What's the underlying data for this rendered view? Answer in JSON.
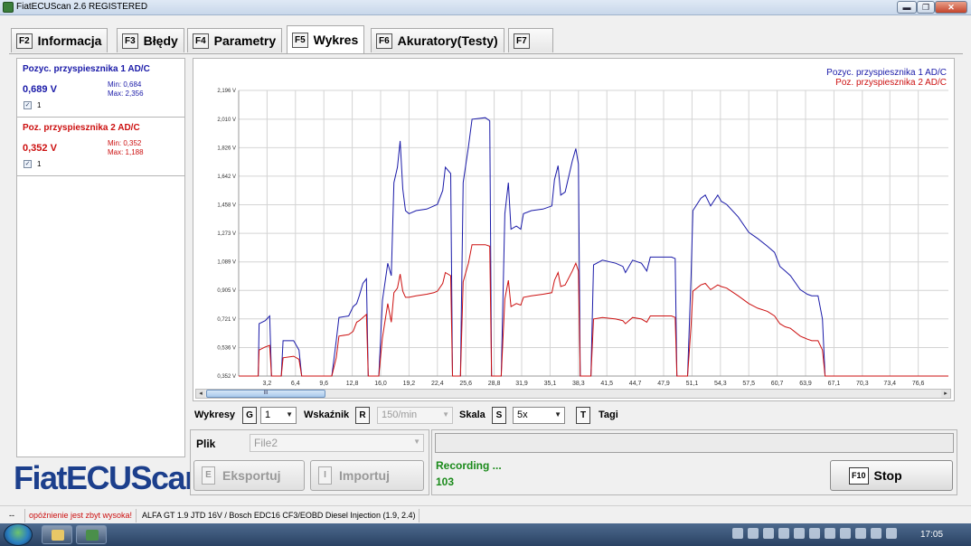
{
  "window": {
    "title": "FiatECUScan 2.6 REGISTERED",
    "min_glyph": "▬",
    "restore_glyph": "❐",
    "close_glyph": "✕"
  },
  "tabs": [
    {
      "key": "F2",
      "label": "Informacja"
    },
    {
      "key": "F3",
      "label": "Błędy"
    },
    {
      "key": "F4",
      "label": "Parametry"
    },
    {
      "key": "F5",
      "label": "Wykres",
      "active": true
    },
    {
      "key": "F6",
      "label": "Akuratory(Testy)"
    },
    {
      "key": "F7",
      "label": ""
    }
  ],
  "sensors": [
    {
      "name": "Pozyc. przyspiesznika 1 AD/C",
      "value": "0,689 V",
      "min": "Min: 0,684",
      "max": "Max: 2,356",
      "checkbox_label": "1",
      "checked": true,
      "color": "#1a1aa8"
    },
    {
      "name": "Poz. przyspiesznika 2 AD/C",
      "value": "0,352 V",
      "min": "Min: 0,352",
      "max": "Max: 1,188",
      "checkbox_label": "1",
      "checked": true,
      "color": "#cc1010"
    }
  ],
  "logo": "FiatECUScan",
  "chart_data": {
    "type": "line",
    "title": "",
    "xlabel": "",
    "ylabel": "",
    "xlim": [
      0,
      80
    ],
    "ylim": [
      0.352,
      2.196
    ],
    "x_ticks": [
      "3,2",
      "6,4",
      "9,6",
      "12,8",
      "16,0",
      "19,2",
      "22,4",
      "25,6",
      "28,8",
      "31,9",
      "35,1",
      "38,3",
      "41,5",
      "44,7",
      "47,9",
      "51,1",
      "54,3",
      "57,5",
      "60,7",
      "63,9",
      "67,1",
      "70,3",
      "73,4",
      "76,6"
    ],
    "x_tick_values": [
      3.2,
      6.4,
      9.6,
      12.8,
      16.0,
      19.2,
      22.4,
      25.6,
      28.8,
      31.9,
      35.1,
      38.3,
      41.5,
      44.7,
      47.9,
      51.1,
      54.3,
      57.5,
      60.7,
      63.9,
      67.1,
      70.3,
      73.4,
      76.6
    ],
    "y_ticks": [
      "0,352 V",
      "0,536 V",
      "0,721 V",
      "0,905 V",
      "1,089 V",
      "1,273 V",
      "1,458 V",
      "1,642 V",
      "1,826 V",
      "2,010 V",
      "2,196 V"
    ],
    "y_tick_values": [
      0.352,
      0.536,
      0.721,
      0.905,
      1.089,
      1.273,
      1.458,
      1.642,
      1.826,
      2.01,
      2.196
    ],
    "grid": true,
    "legend_position": "top-right",
    "series": [
      {
        "name": "Pozyc. przyspiesznika 1 AD/C",
        "color": "#1a1aa8",
        "points": [
          [
            0,
            0.352
          ],
          [
            2.2,
            0.352
          ],
          [
            2.3,
            0.69
          ],
          [
            3.0,
            0.71
          ],
          [
            3.5,
            0.74
          ],
          [
            3.7,
            0.352
          ],
          [
            4.8,
            0.352
          ],
          [
            5.0,
            0.58
          ],
          [
            6.2,
            0.58
          ],
          [
            6.8,
            0.52
          ],
          [
            7.1,
            0.352
          ],
          [
            10.5,
            0.352
          ],
          [
            11.0,
            0.58
          ],
          [
            11.3,
            0.73
          ],
          [
            12.4,
            0.74
          ],
          [
            12.9,
            0.8
          ],
          [
            13.3,
            0.82
          ],
          [
            13.6,
            0.87
          ],
          [
            14.0,
            0.95
          ],
          [
            14.4,
            0.98
          ],
          [
            14.6,
            0.352
          ],
          [
            15.8,
            0.352
          ],
          [
            16.2,
            0.84
          ],
          [
            16.8,
            1.08
          ],
          [
            17.2,
            1.0
          ],
          [
            17.5,
            1.6
          ],
          [
            17.9,
            1.7
          ],
          [
            18.2,
            1.87
          ],
          [
            18.5,
            1.56
          ],
          [
            18.8,
            1.42
          ],
          [
            19.2,
            1.4
          ],
          [
            20.0,
            1.42
          ],
          [
            21.2,
            1.43
          ],
          [
            22.0,
            1.45
          ],
          [
            22.4,
            1.46
          ],
          [
            23.0,
            1.55
          ],
          [
            23.3,
            1.7
          ],
          [
            23.9,
            1.66
          ],
          [
            24.1,
            0.352
          ],
          [
            25.0,
            0.352
          ],
          [
            25.3,
            1.6
          ],
          [
            25.9,
            1.83
          ],
          [
            26.3,
            2.01
          ],
          [
            27.8,
            2.02
          ],
          [
            28.3,
            2.0
          ],
          [
            28.5,
            0.352
          ],
          [
            29.6,
            0.352
          ],
          [
            30.0,
            1.4
          ],
          [
            30.4,
            1.6
          ],
          [
            30.7,
            1.3
          ],
          [
            31.3,
            1.32
          ],
          [
            31.8,
            1.3
          ],
          [
            32.1,
            1.4
          ],
          [
            33.0,
            1.42
          ],
          [
            34.3,
            1.43
          ],
          [
            35.3,
            1.45
          ],
          [
            35.6,
            1.62
          ],
          [
            36.0,
            1.71
          ],
          [
            36.3,
            1.52
          ],
          [
            36.8,
            1.54
          ],
          [
            37.6,
            1.74
          ],
          [
            38.0,
            1.82
          ],
          [
            38.3,
            1.72
          ],
          [
            38.5,
            0.352
          ],
          [
            39.7,
            0.352
          ],
          [
            40.0,
            1.07
          ],
          [
            41.0,
            1.1
          ],
          [
            42.5,
            1.08
          ],
          [
            43.3,
            1.06
          ],
          [
            43.6,
            1.02
          ],
          [
            44.4,
            1.1
          ],
          [
            45.4,
            1.08
          ],
          [
            46.0,
            1.03
          ],
          [
            46.4,
            1.12
          ],
          [
            47.4,
            1.12
          ],
          [
            48.8,
            1.12
          ],
          [
            49.2,
            1.11
          ],
          [
            49.4,
            0.352
          ],
          [
            50.6,
            0.352
          ],
          [
            51.0,
            1.0
          ],
          [
            51.2,
            1.42
          ],
          [
            52.1,
            1.5
          ],
          [
            52.6,
            1.52
          ],
          [
            53.2,
            1.45
          ],
          [
            54.0,
            1.52
          ],
          [
            54.4,
            1.48
          ],
          [
            55.0,
            1.46
          ],
          [
            56.3,
            1.38
          ],
          [
            57.5,
            1.28
          ],
          [
            58.5,
            1.24
          ],
          [
            59.6,
            1.19
          ],
          [
            60.4,
            1.15
          ],
          [
            61.0,
            1.06
          ],
          [
            61.6,
            1.03
          ],
          [
            62.2,
            1.0
          ],
          [
            63.3,
            0.91
          ],
          [
            64.1,
            0.88
          ],
          [
            64.6,
            0.87
          ],
          [
            65.3,
            0.87
          ],
          [
            65.8,
            0.72
          ],
          [
            66.1,
            0.352
          ],
          [
            80.0,
            0.352
          ]
        ]
      },
      {
        "name": "Poz. przyspiesznika 2 AD/C",
        "color": "#cc1010",
        "points": [
          [
            0,
            0.352
          ],
          [
            2.2,
            0.352
          ],
          [
            2.3,
            0.52
          ],
          [
            3.0,
            0.54
          ],
          [
            3.5,
            0.55
          ],
          [
            3.7,
            0.352
          ],
          [
            4.8,
            0.352
          ],
          [
            5.0,
            0.47
          ],
          [
            6.2,
            0.48
          ],
          [
            6.8,
            0.46
          ],
          [
            7.1,
            0.352
          ],
          [
            10.5,
            0.352
          ],
          [
            11.0,
            0.47
          ],
          [
            11.3,
            0.61
          ],
          [
            12.4,
            0.62
          ],
          [
            12.9,
            0.64
          ],
          [
            13.3,
            0.7
          ],
          [
            13.6,
            0.71
          ],
          [
            14.0,
            0.73
          ],
          [
            14.4,
            0.75
          ],
          [
            14.6,
            0.352
          ],
          [
            15.8,
            0.352
          ],
          [
            16.2,
            0.6
          ],
          [
            16.8,
            0.82
          ],
          [
            17.2,
            0.7
          ],
          [
            17.5,
            0.89
          ],
          [
            17.9,
            0.92
          ],
          [
            18.2,
            1.01
          ],
          [
            18.5,
            0.9
          ],
          [
            18.8,
            0.86
          ],
          [
            19.2,
            0.86
          ],
          [
            20.0,
            0.87
          ],
          [
            21.2,
            0.88
          ],
          [
            22.0,
            0.89
          ],
          [
            22.4,
            0.9
          ],
          [
            23.0,
            0.95
          ],
          [
            23.3,
            1.02
          ],
          [
            23.9,
            1.0
          ],
          [
            24.1,
            0.352
          ],
          [
            25.0,
            0.352
          ],
          [
            25.3,
            0.96
          ],
          [
            25.9,
            1.08
          ],
          [
            26.3,
            1.2
          ],
          [
            27.8,
            1.2
          ],
          [
            28.3,
            1.19
          ],
          [
            28.5,
            0.352
          ],
          [
            29.6,
            0.352
          ],
          [
            30.0,
            0.85
          ],
          [
            30.4,
            0.97
          ],
          [
            30.7,
            0.8
          ],
          [
            31.3,
            0.82
          ],
          [
            31.8,
            0.81
          ],
          [
            32.1,
            0.86
          ],
          [
            33.0,
            0.87
          ],
          [
            34.3,
            0.88
          ],
          [
            35.3,
            0.89
          ],
          [
            35.6,
            0.97
          ],
          [
            36.0,
            1.02
          ],
          [
            36.3,
            0.93
          ],
          [
            36.8,
            0.94
          ],
          [
            37.6,
            1.03
          ],
          [
            38.0,
            1.08
          ],
          [
            38.3,
            1.03
          ],
          [
            38.5,
            0.352
          ],
          [
            39.7,
            0.352
          ],
          [
            40.0,
            0.72
          ],
          [
            41.0,
            0.73
          ],
          [
            42.5,
            0.72
          ],
          [
            43.3,
            0.71
          ],
          [
            43.6,
            0.69
          ],
          [
            44.4,
            0.73
          ],
          [
            45.4,
            0.72
          ],
          [
            46.0,
            0.7
          ],
          [
            46.4,
            0.74
          ],
          [
            47.4,
            0.74
          ],
          [
            48.8,
            0.74
          ],
          [
            49.2,
            0.73
          ],
          [
            49.4,
            0.352
          ],
          [
            50.6,
            0.352
          ],
          [
            51.0,
            0.68
          ],
          [
            51.2,
            0.9
          ],
          [
            52.1,
            0.94
          ],
          [
            52.6,
            0.95
          ],
          [
            53.2,
            0.91
          ],
          [
            54.0,
            0.94
          ],
          [
            54.4,
            0.93
          ],
          [
            55.0,
            0.92
          ],
          [
            56.3,
            0.87
          ],
          [
            57.5,
            0.82
          ],
          [
            58.5,
            0.79
          ],
          [
            59.6,
            0.77
          ],
          [
            60.4,
            0.74
          ],
          [
            61.0,
            0.69
          ],
          [
            61.6,
            0.67
          ],
          [
            62.2,
            0.66
          ],
          [
            63.3,
            0.61
          ],
          [
            64.1,
            0.59
          ],
          [
            64.6,
            0.58
          ],
          [
            65.3,
            0.58
          ],
          [
            65.8,
            0.52
          ],
          [
            66.1,
            0.352
          ],
          [
            80.0,
            0.352
          ]
        ]
      }
    ]
  },
  "scrollbar": {
    "thumb_glyph": "III",
    "left_arrow": "◂",
    "right_arrow": "▸"
  },
  "controls": {
    "wykresy_label": "Wykresy",
    "wykresy_key": "G",
    "wykresy_value": "1",
    "wskaznik_label": "Wskaźnik",
    "wskaznik_key": "R",
    "wskaznik_value": "150/min",
    "skala_label": "Skala",
    "skala_key": "S",
    "skala_value": "5x",
    "tagi_key": "T",
    "tagi_label": "Tagi",
    "dropdown_glyph": "▼"
  },
  "file_panel": {
    "label": "Plik",
    "file_value": "File2",
    "export_key": "E",
    "export_label": "Eksportuj",
    "import_key": "I",
    "import_label": "Importuj"
  },
  "recording": {
    "status": "Recording ...",
    "count": "103",
    "stop_key": "F10",
    "stop_label": "Stop"
  },
  "status_bar": {
    "cell1": "--",
    "warning": "opóźnienie jest zbyt wysoka!",
    "vehicle": "ALFA GT 1.9 JTD 16V / Bosch EDC16 CF3/EOBD Diesel Injection (1.9, 2.4)",
    "warning_color": "#cc1010"
  },
  "taskbar": {
    "clock": "17:05"
  }
}
